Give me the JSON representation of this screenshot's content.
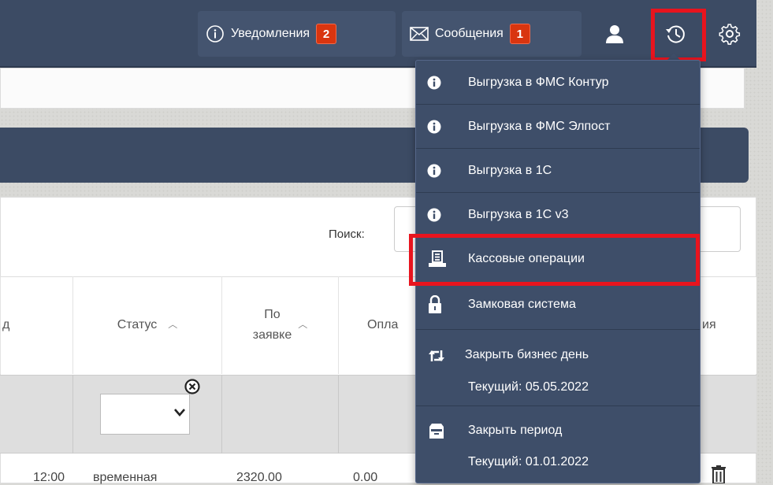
{
  "navbar": {
    "notifications_label": "Уведомления",
    "notifications_count": "2",
    "messages_label": "Сообщения",
    "messages_count": "1",
    "icons": [
      "info-icon",
      "envelope-icon",
      "user-icon",
      "history-icon",
      "gear-icon"
    ]
  },
  "search": {
    "label": "Поиск:",
    "placeholder": ""
  },
  "table": {
    "headers": [
      {
        "label": "д",
        "sortable": false
      },
      {
        "label": "Статус",
        "sortable": true
      },
      {
        "label_line1": "По",
        "label_line2": "заявке",
        "sortable": true
      },
      {
        "label": "Опла",
        "sortable": false
      },
      {
        "label": "ия",
        "sortable": false
      }
    ],
    "filter_status_value": "",
    "first_row": [
      "12:00",
      "временная",
      "2320.00",
      "0.00"
    ]
  },
  "dropdown": {
    "items": [
      {
        "label": "Выгрузка в ФМС Контур",
        "icon": "info-circle-icon"
      },
      {
        "label": "Выгрузка в ФМС Элпост",
        "icon": "info-circle-icon"
      },
      {
        "label": "Выгрузка в 1С",
        "icon": "info-circle-icon"
      },
      {
        "label": "Выгрузка в 1С v3",
        "icon": "info-circle-icon"
      },
      {
        "label": "Кассовые операции",
        "icon": "cash-register-icon"
      },
      {
        "label": "Замковая система",
        "icon": "lock-icon"
      },
      {
        "label": "Закрыть бизнес день",
        "sub": "Текущий: 05.05.2022",
        "icon": "retweet-icon"
      },
      {
        "label": "Закрыть период",
        "sub": "Текущий: 01.01.2022",
        "icon": "archive-icon"
      }
    ]
  },
  "colors": {
    "navbar": "#3c4b64",
    "dropdown": "#3e4e69",
    "badge": "#d9350f",
    "highlight": "#e8141e"
  }
}
